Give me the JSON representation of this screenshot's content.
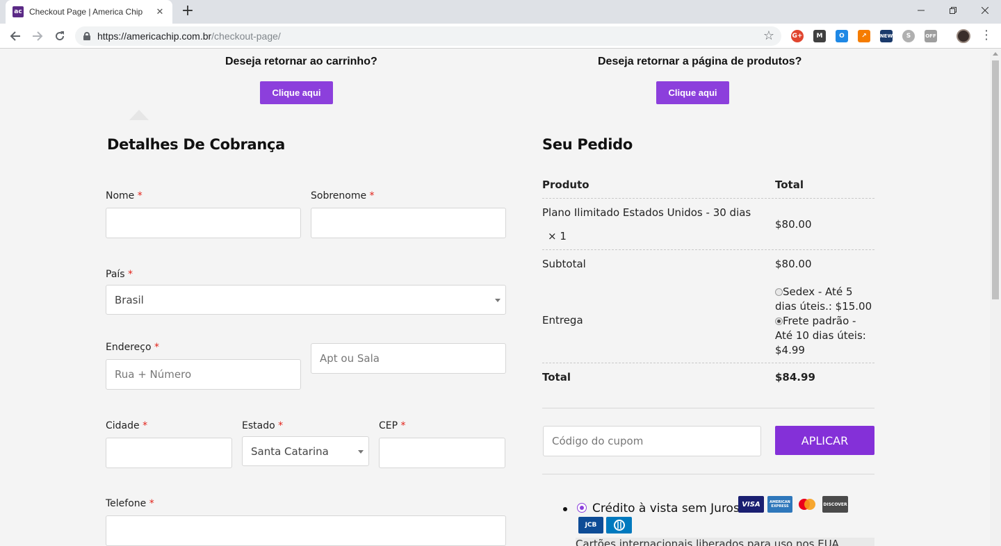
{
  "browser": {
    "tab_title": "Checkout Page | America Chip",
    "favicon_text": "ac",
    "tab_close": "✕",
    "new_tab": "+",
    "url_host": "https://americachip.com.br",
    "url_path": "/checkout-page/",
    "icons": [
      "back-icon",
      "forward-icon",
      "reload-icon",
      "lock-icon",
      "star-icon",
      "menu-icon"
    ],
    "extensions": [
      {
        "name": "google-plus-extension-icon",
        "text": "G+",
        "color": "#e0452e"
      },
      {
        "name": "gmail-extension-icon",
        "text": "M",
        "color": "#404040"
      },
      {
        "name": "outlook-extension-icon",
        "text": "O",
        "color": "#1e88e5"
      },
      {
        "name": "analytics-extension-icon",
        "text": "↗",
        "color": "#f57c00"
      },
      {
        "name": "news-extension-icon",
        "text": "NEW",
        "color": "#1a3a6b"
      },
      {
        "name": "skype-extension-icon",
        "text": "S",
        "color": "#b0b0b0"
      },
      {
        "name": "off-extension-icon",
        "text": "OFF",
        "color": "#9e9e9e"
      }
    ]
  },
  "top_ctas": {
    "cart_question": "Deseja retornar ao carrinho?",
    "cart_button": "Clique aqui",
    "products_question": "Deseja retornar a página de produtos?",
    "products_button": "Clique aqui"
  },
  "billing": {
    "title": "Detalhes De Cobrança",
    "required_mark": "*",
    "first_name_label": "Nome",
    "last_name_label": "Sobrenome",
    "country_label": "País",
    "country_value": "Brasil",
    "address_label": "Endereço",
    "address_placeholder": "Rua + Número",
    "apt_placeholder": "Apt ou Sala",
    "city_label": "Cidade",
    "state_label": "Estado",
    "state_value": "Santa Catarina",
    "zip_label": "CEP",
    "phone_label": "Telefone"
  },
  "order": {
    "title": "Seu Pedido",
    "col_product": "Produto",
    "col_total": "Total",
    "item_name": "Plano Ilimitado Estados Unidos - 30 dias",
    "item_qty": "× 1",
    "item_total": "$80.00",
    "subtotal_label": "Subtotal",
    "subtotal_value": "$80.00",
    "shipping_label": "Entrega",
    "shipping_opt1_line1": "Sedex - Até 5",
    "shipping_opt1_line2": "dias úteis.: $15.00",
    "shipping_opt2_line1": "Frete padrão -",
    "shipping_opt2_line2": "Até 10 dias úteis:",
    "shipping_opt2_line3": "$4.99",
    "total_label": "Total",
    "total_value": "$84.99"
  },
  "coupon": {
    "placeholder": "Código do cupom",
    "apply_button": "APLICAR"
  },
  "payment": {
    "method_label": "Crédito à vista sem Juros.",
    "cards": {
      "visa": "VISA",
      "amex_line1": "AMERICAN",
      "amex_line2": "EXPRESS",
      "discover": "DISCOVER",
      "jcb": "JCB"
    },
    "note": "Cartões internacionais liberados para uso nos EUA"
  }
}
